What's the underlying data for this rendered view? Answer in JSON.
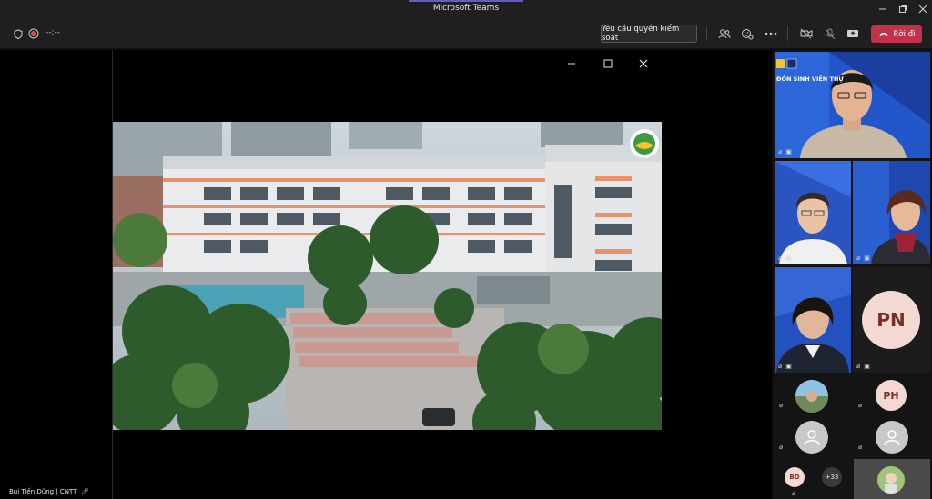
{
  "window": {
    "title": "Microsoft Teams"
  },
  "toolbar": {
    "recording_time": "--:--",
    "request_control_label": "Yêu cầu quyền kiểm soát",
    "leave_label": "Rời đi",
    "leave_color": "#c4314b"
  },
  "stage": {
    "presenter_name": "Bùi Tiến Dũng | CNTT",
    "banner_text": "ĐÓN SINH VIÊN THỰ"
  },
  "participants": {
    "initials_pn": "PN",
    "initials_ph": "PH",
    "initials_bd": "BD",
    "overflow_count": "+33"
  }
}
